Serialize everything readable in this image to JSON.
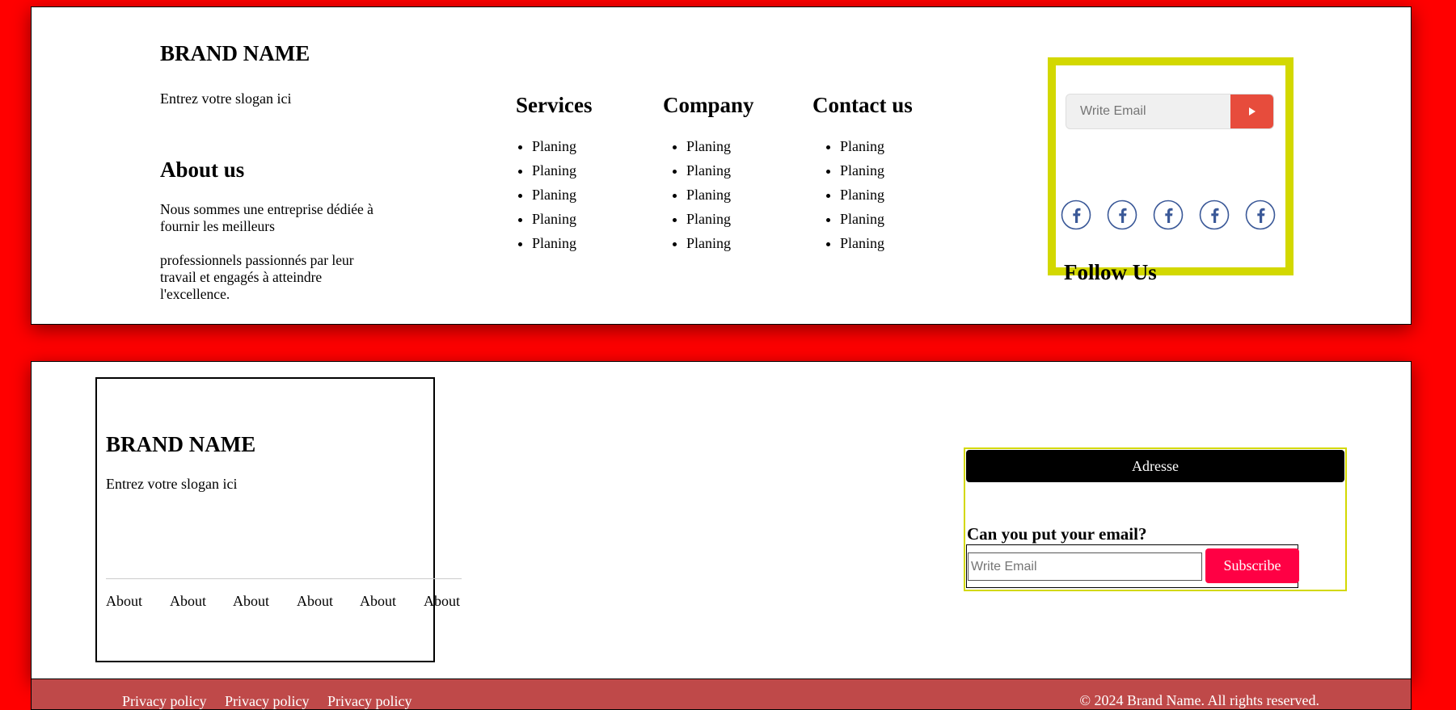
{
  "top_footer": {
    "brand": {
      "name": "BRAND NAME",
      "slogan": "Entrez votre slogan ici"
    },
    "about": {
      "heading": "About us",
      "paragraph1": "Nous sommes une entreprise dédiée à fournir les meilleurs",
      "paragraph2": "professionnels passionnés par leur travail et engagés à atteindre l'excellence."
    },
    "columns": [
      {
        "heading": "Services",
        "items": [
          "Planing",
          "Planing",
          "Planing",
          "Planing",
          "Planing"
        ]
      },
      {
        "heading": "Company",
        "items": [
          "Planing",
          "Planing",
          "Planing",
          "Planing",
          "Planing"
        ]
      },
      {
        "heading": "Contact us",
        "items": [
          "Planing",
          "Planing",
          "Planing",
          "Planing",
          "Planing"
        ]
      }
    ],
    "subscribe": {
      "placeholder": "Write Email",
      "send_icon": "play-triangle-icon"
    },
    "social": {
      "icons": [
        "facebook-icon",
        "facebook-icon",
        "facebook-icon",
        "facebook-icon",
        "facebook-icon"
      ],
      "heading": "Follow Us"
    }
  },
  "second_footer": {
    "brand": {
      "name": "BRAND NAME",
      "slogan": "Entrez votre slogan ici"
    },
    "links": [
      "About",
      "About",
      "About",
      "About",
      "About",
      "About"
    ],
    "address_button": "Adresse",
    "email_question": "Can you put your email?",
    "email_placeholder": "Write Email",
    "subscribe_button": "Subscribe"
  },
  "bottom_bar": {
    "policies": [
      "Privacy policy",
      "Privacy policy",
      "Privacy policy"
    ],
    "copyright": "© 2024 Brand Name. All rights reserved."
  },
  "colors": {
    "page_background": "#ff0000",
    "highlight_border": "#d3d800",
    "send_button": "#e74c3c",
    "subscribe_button": "#ff0044",
    "bottom_bar": "#bf4949",
    "social_icon": "#3b5998"
  }
}
